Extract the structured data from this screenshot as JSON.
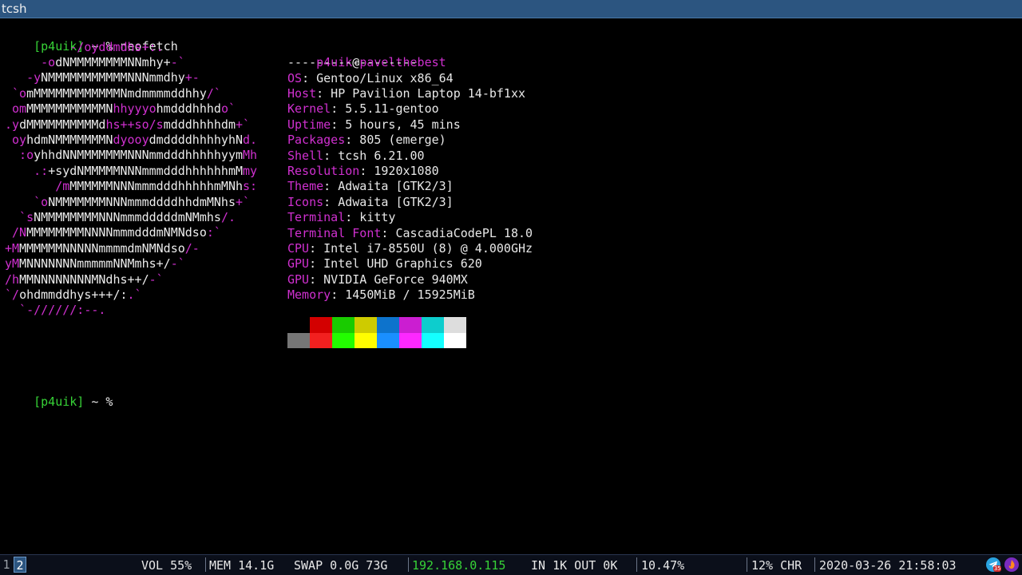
{
  "window": {
    "title": "tcsh"
  },
  "prompt": {
    "user_part": "[p4uik]",
    "rest": " ~ % ",
    "command": "neofetch"
  },
  "ascii_art": [
    [
      {
        "t": "         -/oyddmdhs+:.",
        "c": "magenta"
      }
    ],
    [
      {
        "t": "     -o",
        "c": "magenta"
      },
      {
        "t": "dNMMMMMMMMNNmhy+",
        "c": "white"
      },
      {
        "t": "-`",
        "c": "magenta"
      }
    ],
    [
      {
        "t": "   -y",
        "c": "magenta"
      },
      {
        "t": "NMMMMMMMMMMMNNNmmdhy",
        "c": "white"
      },
      {
        "t": "+-",
        "c": "magenta"
      }
    ],
    [
      {
        "t": " `o",
        "c": "magenta"
      },
      {
        "t": "mMMMMMMMMMMMMNmdmmmmddhhy",
        "c": "white"
      },
      {
        "t": "/`",
        "c": "magenta"
      }
    ],
    [
      {
        "t": " om",
        "c": "magenta"
      },
      {
        "t": "MMMMMMMMMMMN",
        "c": "white"
      },
      {
        "t": "hhyyyo",
        "c": "magenta"
      },
      {
        "t": "hmdddhhhd",
        "c": "white"
      },
      {
        "t": "o`",
        "c": "magenta"
      }
    ],
    [
      {
        "t": ".y",
        "c": "magenta"
      },
      {
        "t": "dMMMMMMMMMMd",
        "c": "white"
      },
      {
        "t": "hs++so/s",
        "c": "magenta"
      },
      {
        "t": "mdddhhhhdm",
        "c": "white"
      },
      {
        "t": "+`",
        "c": "magenta"
      }
    ],
    [
      {
        "t": " oy",
        "c": "magenta"
      },
      {
        "t": "hdmNMMMMMMMN",
        "c": "white"
      },
      {
        "t": "dyooy",
        "c": "magenta"
      },
      {
        "t": "dmddddhhhhyhN",
        "c": "white"
      },
      {
        "t": "d.",
        "c": "magenta"
      }
    ],
    [
      {
        "t": "  :o",
        "c": "magenta"
      },
      {
        "t": "yhhdNNMMMMMMMNNNmmdddhhhhhyym",
        "c": "white"
      },
      {
        "t": "Mh",
        "c": "magenta"
      }
    ],
    [
      {
        "t": "    .:",
        "c": "magenta"
      },
      {
        "t": "+sydNMMMMMNNNmmmdddhhhhhhmM",
        "c": "white"
      },
      {
        "t": "my",
        "c": "magenta"
      }
    ],
    [
      {
        "t": "       /m",
        "c": "magenta"
      },
      {
        "t": "MMMMMMNNNmmmdddhhhhhmMNh",
        "c": "white"
      },
      {
        "t": "s:",
        "c": "magenta"
      }
    ],
    [
      {
        "t": "    `o",
        "c": "magenta"
      },
      {
        "t": "NMMMMMMMNNNmmmddddhhdmMNhs",
        "c": "white"
      },
      {
        "t": "+`",
        "c": "magenta"
      }
    ],
    [
      {
        "t": "  `s",
        "c": "magenta"
      },
      {
        "t": "NMMMMMMMMNNNmmmdddddmNMmhs",
        "c": "white"
      },
      {
        "t": "/.",
        "c": "magenta"
      }
    ],
    [
      {
        "t": " /N",
        "c": "magenta"
      },
      {
        "t": "MMMMMMMMNNNNmmmdddmNMNdso",
        "c": "white"
      },
      {
        "t": ":`",
        "c": "magenta"
      }
    ],
    [
      {
        "t": "+M",
        "c": "magenta"
      },
      {
        "t": "MMMMMMNNNNNmmmmdmNMNdso",
        "c": "white"
      },
      {
        "t": "/-",
        "c": "magenta"
      }
    ],
    [
      {
        "t": "yM",
        "c": "magenta"
      },
      {
        "t": "MNNNNNNNmmmmmNNMmhs+/",
        "c": "white"
      },
      {
        "t": "-`",
        "c": "magenta"
      }
    ],
    [
      {
        "t": "/h",
        "c": "magenta"
      },
      {
        "t": "MMNNNNNNNNMNdhs++/",
        "c": "white"
      },
      {
        "t": "-`",
        "c": "magenta"
      }
    ],
    [
      {
        "t": "`/",
        "c": "magenta"
      },
      {
        "t": "ohdmmddhys+++/:",
        "c": "white"
      },
      {
        "t": ".`",
        "c": "magenta"
      }
    ],
    [
      {
        "t": "  `-//////:--.",
        "c": "magenta"
      }
    ]
  ],
  "info": {
    "user": "p4uik",
    "at": "@",
    "host": "pavelthebest",
    "separator": "------------------",
    "fields": [
      {
        "key": "OS",
        "value": ": Gentoo/Linux x86_64"
      },
      {
        "key": "Host",
        "value": ": HP Pavilion Laptop 14-bf1xx"
      },
      {
        "key": "Kernel",
        "value": ": 5.5.11-gentoo"
      },
      {
        "key": "Uptime",
        "value": ": 5 hours, 45 mins"
      },
      {
        "key": "Packages",
        "value": ": 805 (emerge)"
      },
      {
        "key": "Shell",
        "value": ": tcsh 6.21.00"
      },
      {
        "key": "Resolution",
        "value": ": 1920x1080"
      },
      {
        "key": "Theme",
        "value": ": Adwaita [GTK2/3]"
      },
      {
        "key": "Icons",
        "value": ": Adwaita [GTK2/3]"
      },
      {
        "key": "Terminal",
        "value": ": kitty"
      },
      {
        "key": "Terminal Font",
        "value": ": CascadiaCodePL 18.0"
      },
      {
        "key": "CPU",
        "value": ": Intel i7-8550U (8) @ 4.000GHz"
      },
      {
        "key": "GPU",
        "value": ": Intel UHD Graphics 620"
      },
      {
        "key": "GPU",
        "value": ": NVIDIA GeForce 940MX"
      },
      {
        "key": "Memory",
        "value": ": 1450MiB / 15925MiB"
      }
    ]
  },
  "palette": {
    "normal": [
      "#000000",
      "#d30000",
      "#19cb00",
      "#cecb00",
      "#0d73cc",
      "#cb1ed1",
      "#0dcdcd",
      "#dddddd"
    ],
    "bright": [
      "#767676",
      "#f2201f",
      "#23fd00",
      "#fffd00",
      "#1a8fff",
      "#fd28ff",
      "#14ffff",
      "#ffffff"
    ]
  },
  "prompt2": {
    "user_part": "[p4uik]",
    "rest": " ~ % "
  },
  "statusbar": {
    "workspaces": [
      "1",
      "2"
    ],
    "vol": "VOL 55%",
    "mem": "MEM 14.1G",
    "swap": "SWAP 0.0G 73G",
    "ip": "192.168.0.115",
    "net": "IN 1K OUT 0K",
    "cpu": "10.47%",
    "battery": "12% CHR",
    "datetime": "2020-03-26 21:58:03",
    "telegram_badge": "35",
    "ip_color": "#37d337"
  }
}
